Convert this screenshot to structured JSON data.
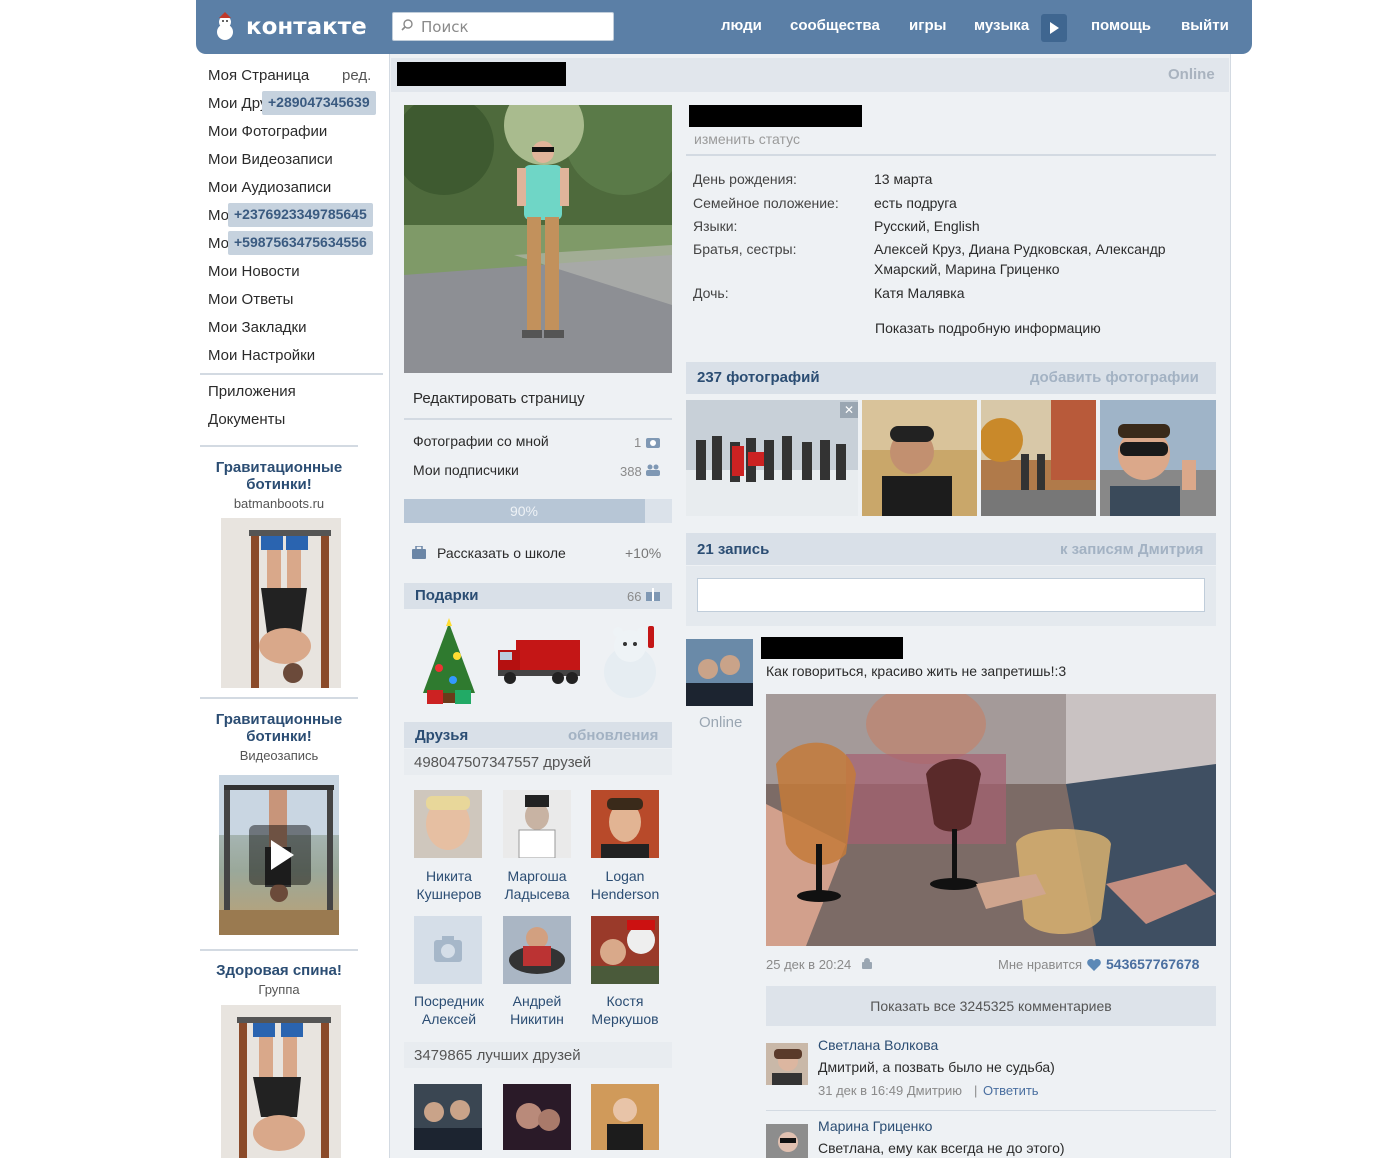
{
  "header": {
    "logo_text": "контакте",
    "search_placeholder": "Поиск",
    "nav": [
      "люди",
      "сообщества",
      "игры",
      "музыка",
      "помощь",
      "выйти"
    ]
  },
  "sidebar": {
    "items": [
      "Моя Страница",
      "Мои Друзья",
      "Мои Фотографии",
      "Мои Видеозаписи",
      "Мои Аудиозаписи",
      "Мои Сообщения",
      "Мои Группы",
      "Мои Новости",
      "Мои Ответы",
      "Мои Закладки",
      "Мои Настройки"
    ],
    "edit_label": "ред.",
    "badges": [
      "+289047345639",
      "+2376923349785645",
      "+5987563475634556"
    ],
    "extra": [
      "Приложения",
      "Документы"
    ],
    "ads": [
      {
        "title": "Гравитационные ботинки!",
        "sub": "batmanboots.ru"
      },
      {
        "title": "Гравитационные ботинки!",
        "sub": "Видеозапись"
      },
      {
        "title": "Здоровая спина!",
        "sub": "Группа"
      }
    ]
  },
  "profile": {
    "online": "Online",
    "change_status": "изменить статус",
    "info": [
      {
        "label": "День рождения:",
        "value": "13 марта"
      },
      {
        "label": "Семейное положение:",
        "value": "есть подруга"
      },
      {
        "label": "Языки:",
        "value": "Русский, English"
      },
      {
        "label": "Братья, сестры:",
        "value": "Алексей Круз, Диана Рудковская, Александр",
        "value2": "Хмарский, Марина Гриценко"
      },
      {
        "label": "Дочь:",
        "value": "Катя Малявка"
      }
    ],
    "show_more": "Показать подробную информацию",
    "edit_page": "Редактировать страницу",
    "photos_with_me": "Фотографии со мной",
    "photos_with_me_count": "1",
    "subscribers": "Мои подписчики",
    "subscribers_count": "388",
    "progress_label": "90%",
    "progress_value": 0.9,
    "school": "Рассказать о школе",
    "school_bonus": "+10%",
    "gifts_title": "Подарки",
    "gifts_count": "66",
    "friends_title": "Друзья",
    "friends_updates": "обновления",
    "friends_count": "498047507347557 друзей",
    "friends": [
      {
        "first": "Никита",
        "last": "Кушнеров"
      },
      {
        "first": "Маргоша",
        "last": "Ладысева"
      },
      {
        "first": "Logan",
        "last": "Henderson"
      },
      {
        "first": "Посредник",
        "last": "Алексей"
      },
      {
        "first": "Андрей",
        "last": "Никитин"
      },
      {
        "first": "Костя",
        "last": "Меркушов"
      }
    ],
    "best_friends": "3479865 лучших друзей"
  },
  "photos": {
    "title": "237 фотографий",
    "add": "добавить фотографии"
  },
  "wall": {
    "title": "21 запись",
    "to_posts": "к записям Дмитрия",
    "author_online": "Online",
    "post_text": "Как говориться, красиво жить не запретишь!:3",
    "post_date": "25 дек в 20:24",
    "likes_label": "Мне нравится",
    "likes_count": "543657767678",
    "show_comments": "Показать все 3245325 комментариев",
    "comments": [
      {
        "name": "Светлана Волкова",
        "text": "Дмитрий, а позвать было не судьба)",
        "meta": "31 дек в 16:49 Дмитрию",
        "reply": "Ответить"
      },
      {
        "name": "Марина Гриценко",
        "text": "Светлана, ему как всегда не до этого)"
      }
    ]
  }
}
